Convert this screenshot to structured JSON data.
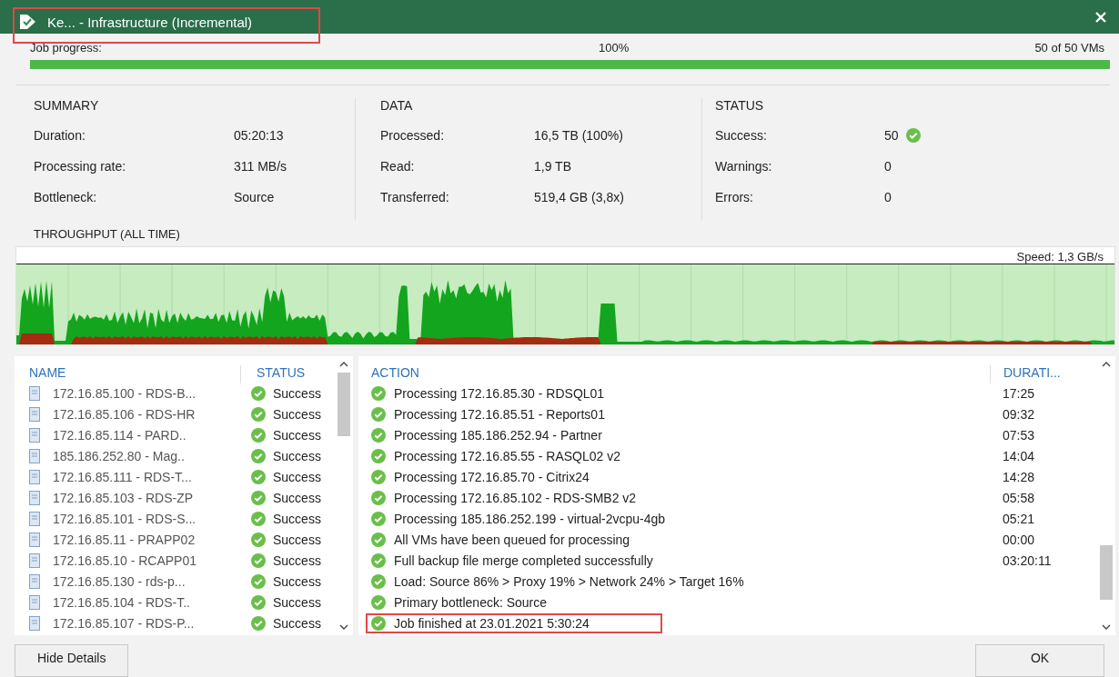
{
  "window": {
    "title": "Ke... - Infrastructure (Incremental)",
    "title_highlighted": true
  },
  "progress": {
    "label": "Job progress:",
    "percent": "100%",
    "count": "50 of 50 VMs",
    "level": 1
  },
  "summary": [
    {
      "heading": "SUMMARY",
      "rows": [
        {
          "label": "Duration:",
          "value": "05:20:13"
        },
        {
          "label": "Processing rate:",
          "value": "311 MB/s"
        },
        {
          "label": "Bottleneck:",
          "value": "Source"
        }
      ]
    },
    {
      "heading": "DATA",
      "rows": [
        {
          "label": "Processed:",
          "value": "16,5 TB (100%)"
        },
        {
          "label": "Read:",
          "value": "1,9 TB"
        },
        {
          "label": "Transferred:",
          "value": "519,4 GB (3,8x)"
        }
      ]
    },
    {
      "heading": "STATUS",
      "rows": [
        {
          "label": "Success:",
          "value": "50",
          "ok": true
        },
        {
          "label": "Warnings:",
          "value": "0",
          "ok": false
        },
        {
          "label": "Errors:",
          "value": "0",
          "ok": false
        }
      ]
    }
  ],
  "throughput": {
    "title": "THROUGHPUT (ALL TIME)",
    "speed": "Speed: 1,3 GB/s"
  },
  "vm_table": {
    "columns": [
      "NAME",
      "STATUS"
    ],
    "rows": [
      {
        "name": "172.16.85.100 - RDS-B...",
        "status": "Success"
      },
      {
        "name": "172.16.85.106 - RDS-HR",
        "status": "Success"
      },
      {
        "name": "172.16.85.114 - PARD..",
        "status": "Success"
      },
      {
        "name": "185.186.252.80 - Mag..",
        "status": "Success"
      },
      {
        "name": "172.16.85.111 - RDS-T...",
        "status": "Success"
      },
      {
        "name": "172.16.85.103 - RDS-ZP",
        "status": "Success"
      },
      {
        "name": "172.16.85.101 - RDS-S...",
        "status": "Success"
      },
      {
        "name": "172.16.85.11 - PRAPP02",
        "status": "Success"
      },
      {
        "name": "172.16.85.10 - RCAPP01",
        "status": "Success"
      },
      {
        "name": "172.16.85.130 - rds-p...",
        "status": "Success"
      },
      {
        "name": "172.16.85.104 - RDS-T..",
        "status": "Success"
      },
      {
        "name": "172.16.85.107 - RDS-P...",
        "status": "Success"
      }
    ]
  },
  "action_table": {
    "columns": [
      "ACTION",
      "DURATI..."
    ],
    "rows": [
      {
        "action": "Processing 172.16.85.30 - RDSQL01",
        "duration": "17:25",
        "highlighted": false
      },
      {
        "action": "Processing 172.16.85.51 - Reports01",
        "duration": "09:32",
        "highlighted": false
      },
      {
        "action": "Processing 185.186.252.94 - Partner",
        "duration": "07:53",
        "highlighted": false
      },
      {
        "action": "Processing 172.16.85.55 - RASQL02 v2",
        "duration": "14:04",
        "highlighted": false
      },
      {
        "action": "Processing 172.16.85.70 - Citrix24",
        "duration": "14:28",
        "highlighted": false
      },
      {
        "action": "Processing 172.16.85.102 - RDS-SMB2 v2",
        "duration": "05:58",
        "highlighted": false
      },
      {
        "action": "Processing 185.186.252.199 - virtual-2vcpu-4gb",
        "duration": "05:21",
        "highlighted": false
      },
      {
        "action": "All VMs have been queued for processing",
        "duration": "00:00",
        "highlighted": false
      },
      {
        "action": "Full backup file merge completed successfully",
        "duration": "03:20:11",
        "highlighted": false
      },
      {
        "action": "Load: Source 86% > Proxy 19% > Network 24% > Target 16%",
        "highlighted": false
      },
      {
        "action": "Primary bottleneck: Source",
        "highlighted": false
      },
      {
        "action": "Job finished at 23.01.2021 5:30:24",
        "highlighted": true
      }
    ]
  },
  "buttons": {
    "left": "Hide Details",
    "right": "OK"
  }
}
